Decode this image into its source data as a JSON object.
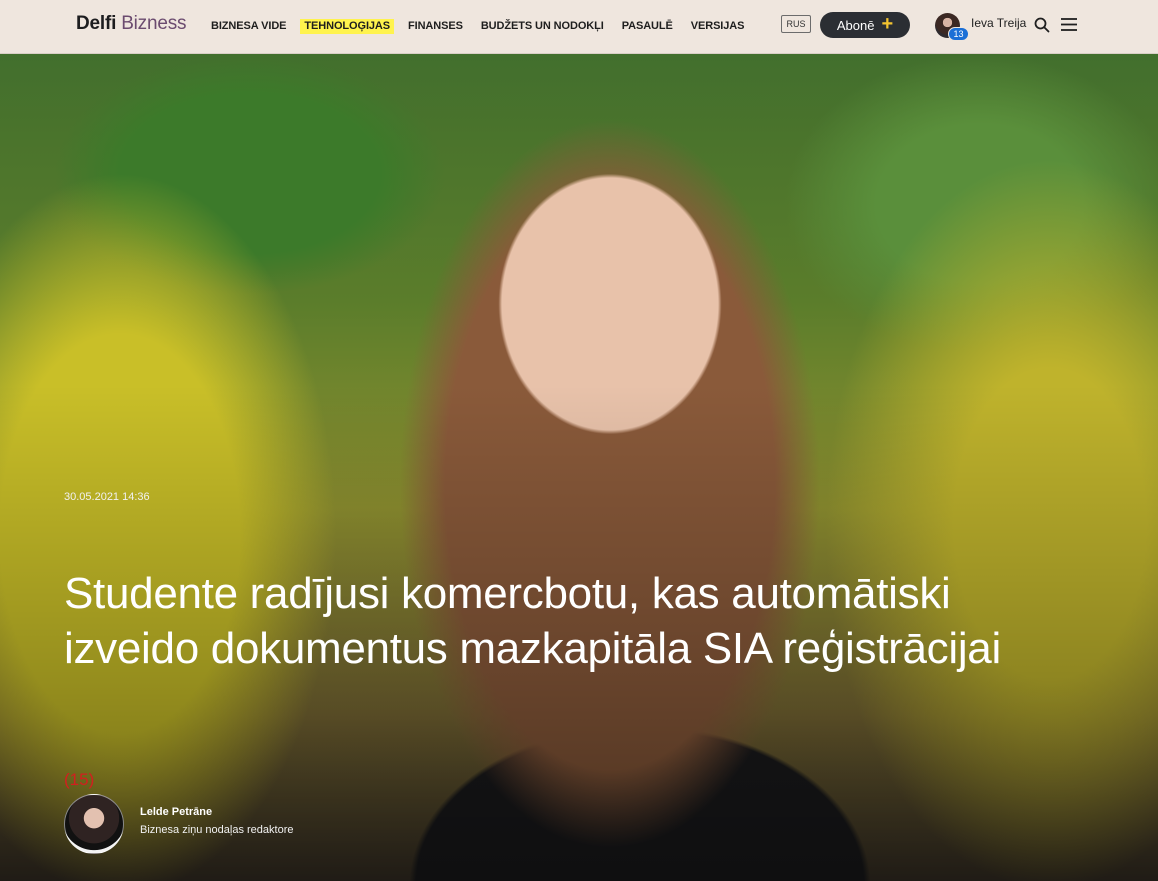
{
  "header": {
    "logo_part1": "Delfi",
    "logo_part2": "Bizness",
    "nav": [
      {
        "label": "BIZNESA VIDE",
        "highlighted": false
      },
      {
        "label": "TEHNOLOĢIJAS",
        "highlighted": true
      },
      {
        "label": "FINANSES",
        "highlighted": false
      },
      {
        "label": "BUDŽETS UN NODOKĻI",
        "highlighted": false
      },
      {
        "label": "PASAULĒ",
        "highlighted": false
      },
      {
        "label": "VERSIJAS",
        "highlighted": false
      }
    ],
    "language_button": "RUS",
    "subscribe_label": "Abonē",
    "subscribe_icon": "+",
    "notification_count": "13",
    "user_name": "Ieva Treija",
    "search_icon": "search-icon",
    "menu_icon": "hamburger-menu-icon"
  },
  "article": {
    "date": "30.05.2021 14:36",
    "title": "Studente radījusi komercbotu, kas automātiski izveido dokumentus mazkapitāla SIA reģistrācijai",
    "comments": "(15)",
    "author_name": "Lelde Petrāne",
    "author_role": "Biznesa ziņu nodaļas redaktore"
  },
  "colors": {
    "header_bg": "#efe6de",
    "highlight": "#fff34d",
    "subscribe_bg": "#2b2e33",
    "plus_color": "#f4c430",
    "badge": "#1b6fd6",
    "comments": "#d21f1f"
  }
}
